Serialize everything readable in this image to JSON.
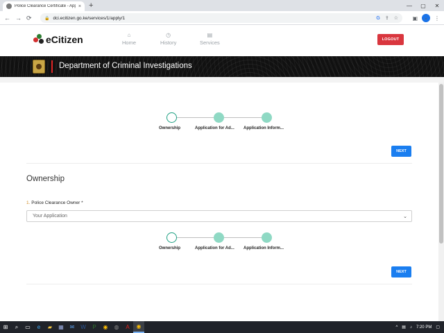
{
  "browser": {
    "tab_title": "Police Clearance Certificate - Appl",
    "tab_close": "×",
    "new_tab": "+",
    "url": "dci.ecitizen.go.ke/services/1/apply/1",
    "nav_back": "←",
    "nav_forward": "→",
    "nav_reload": "⟳",
    "win_min": "—",
    "win_max": "▢",
    "win_close": "✕"
  },
  "header": {
    "logo_text": "eCitizen",
    "menu": [
      {
        "label": "Home",
        "icon": "home-icon"
      },
      {
        "label": "History",
        "icon": "history-icon"
      },
      {
        "label": "Services",
        "icon": "services-icon"
      }
    ],
    "logout_label": "LOGOUT"
  },
  "banner": {
    "department": "Department of Criminal Investigations"
  },
  "stepper": {
    "steps": [
      {
        "label": "Ownership",
        "state": "active"
      },
      {
        "label": "Application for Ad...",
        "state": "pending"
      },
      {
        "label": "Application Inform...",
        "state": "pending"
      }
    ]
  },
  "form": {
    "next_label": "NEXT",
    "section_title": "Ownership",
    "field_number": "1.",
    "field_label": "Police Clearance Owner *",
    "select_value": "Your Application"
  },
  "taskbar": {
    "time": "7:20 PM",
    "lang": "ENG"
  },
  "colors": {
    "logout": "#d9363e",
    "next": "#1a7ef0",
    "step_active_border": "#1b9f80",
    "step_pending": "#8fd9c4",
    "banner_bg": "#111111",
    "banner_accent": "#e02424"
  }
}
